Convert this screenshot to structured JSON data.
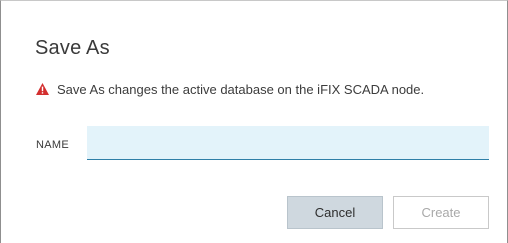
{
  "dialog": {
    "title": "Save As",
    "warning_text": "Save As changes the active database on the iFIX SCADA node.",
    "warning_icon": "warning-triangle-icon",
    "warning_color": "#d32f2f",
    "name_label": "NAME",
    "name_value": "",
    "name_placeholder": "",
    "cancel_label": "Cancel",
    "create_label": "Create",
    "create_enabled": false
  },
  "colors": {
    "input_background": "#e3f3fa",
    "input_underline": "#2f7fa7",
    "cancel_background": "#cfd8df"
  }
}
